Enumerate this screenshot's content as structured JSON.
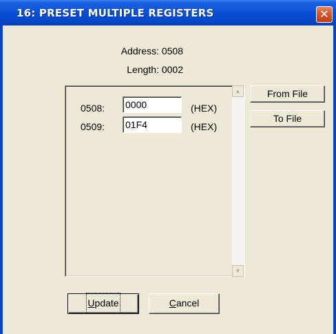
{
  "window": {
    "title": "16: PRESET MULTIPLE REGISTERS",
    "close_symbol": "✕"
  },
  "info": {
    "address": "Address: 0508",
    "length": "Length: 0002"
  },
  "registers": [
    {
      "label": "0508:",
      "value": "0000",
      "unit": "(HEX)"
    },
    {
      "label": "0509:",
      "value": "01F4",
      "unit": "(HEX)"
    }
  ],
  "buttons": {
    "from_file": "From File",
    "to_file": "To File",
    "update_accel": "U",
    "update_rest": "pdate",
    "cancel_accel": "C",
    "cancel_rest": "ancel"
  },
  "scrollbar": {
    "up_icon": "scroll-up-arrow",
    "down_icon": "scroll-down-arrow"
  },
  "colors": {
    "titlebar": "#0a4fd6",
    "close": "#d2572f",
    "dialog": "#ece9d8"
  }
}
